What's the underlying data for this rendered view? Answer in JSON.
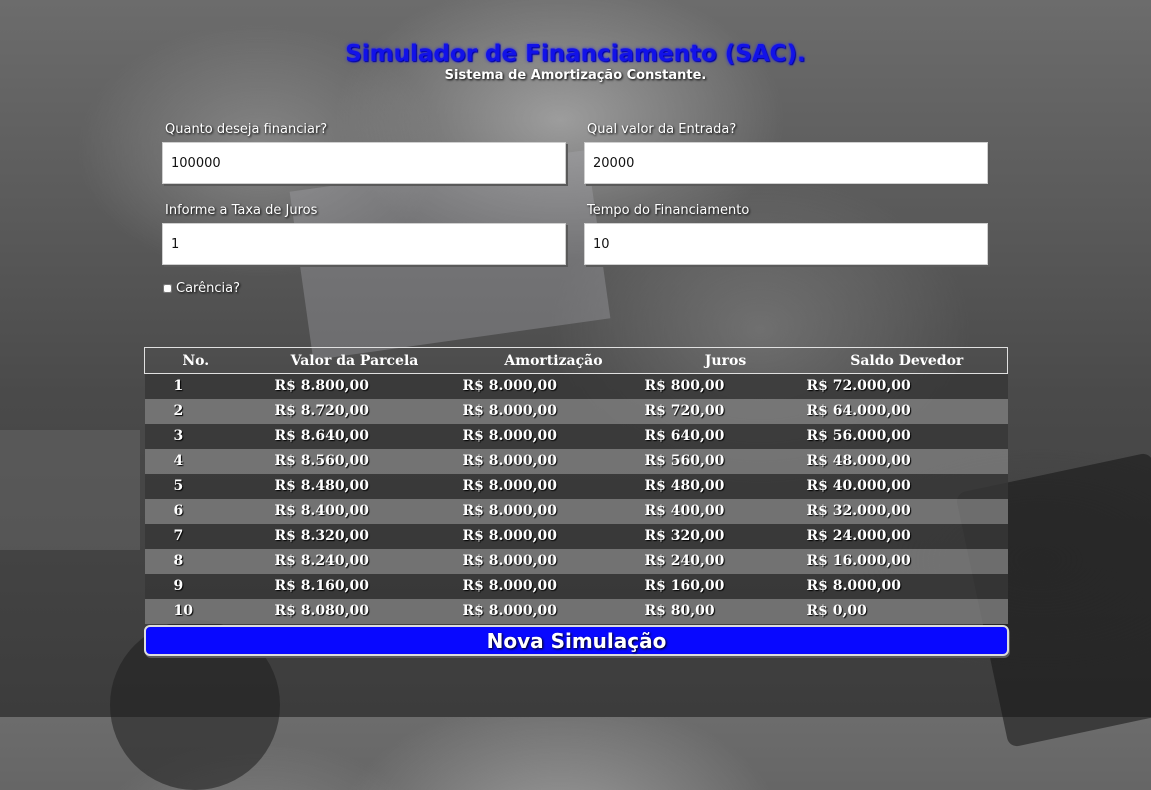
{
  "header": {
    "title": "Simulador de Financiamento (SAC).",
    "subtitle": "Sistema de Amortização Constante."
  },
  "form": {
    "amount": {
      "label": "Quanto deseja financiar?",
      "value": "100000"
    },
    "down_payment": {
      "label": "Qual valor da Entrada?",
      "value": "20000"
    },
    "interest": {
      "label": "Informe a Taxa de Juros",
      "value": "1"
    },
    "term": {
      "label": "Tempo do Financiamento",
      "value": "10"
    },
    "grace": {
      "label": "Carência?",
      "checked": false
    }
  },
  "table": {
    "headers": [
      "No.",
      "Valor da Parcela",
      "Amortização",
      "Juros",
      "Saldo Devedor"
    ],
    "rows": [
      [
        "1",
        "R$ 8.800,00",
        "R$ 8.000,00",
        "R$ 800,00",
        "R$ 72.000,00"
      ],
      [
        "2",
        "R$ 8.720,00",
        "R$ 8.000,00",
        "R$ 720,00",
        "R$ 64.000,00"
      ],
      [
        "3",
        "R$ 8.640,00",
        "R$ 8.000,00",
        "R$ 640,00",
        "R$ 56.000,00"
      ],
      [
        "4",
        "R$ 8.560,00",
        "R$ 8.000,00",
        "R$ 560,00",
        "R$ 48.000,00"
      ],
      [
        "5",
        "R$ 8.480,00",
        "R$ 8.000,00",
        "R$ 480,00",
        "R$ 40.000,00"
      ],
      [
        "6",
        "R$ 8.400,00",
        "R$ 8.000,00",
        "R$ 400,00",
        "R$ 32.000,00"
      ],
      [
        "7",
        "R$ 8.320,00",
        "R$ 8.000,00",
        "R$ 320,00",
        "R$ 24.000,00"
      ],
      [
        "8",
        "R$ 8.240,00",
        "R$ 8.000,00",
        "R$ 240,00",
        "R$ 16.000,00"
      ],
      [
        "9",
        "R$ 8.160,00",
        "R$ 8.000,00",
        "R$ 160,00",
        "R$ 8.000,00"
      ],
      [
        "10",
        "R$ 8.080,00",
        "R$ 8.000,00",
        "R$ 80,00",
        "R$ 0,00"
      ]
    ]
  },
  "actions": {
    "new_simulation_label": "Nova Simulação"
  },
  "colors": {
    "accent": "#0808ff",
    "title": "#1212e8"
  }
}
